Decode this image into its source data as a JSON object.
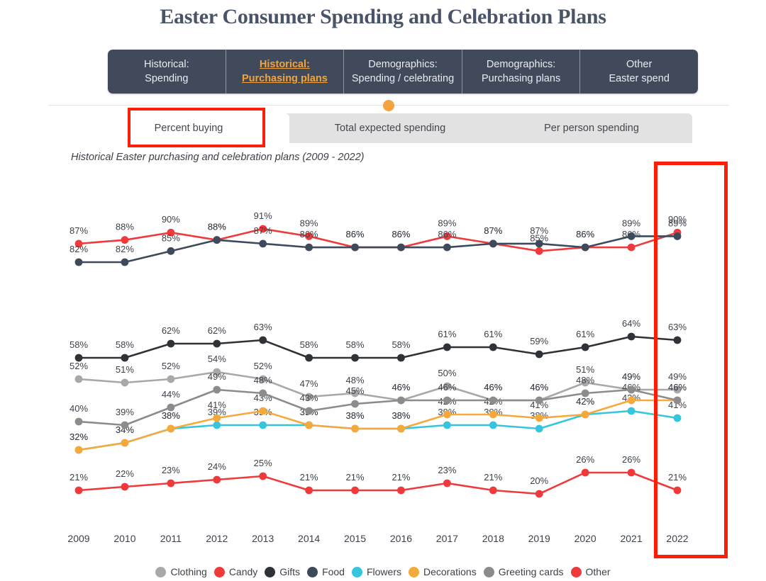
{
  "header": {
    "title": "Easter Consumer Spending and Celebration Plans"
  },
  "topnav": {
    "items": [
      {
        "line1": "Historical:",
        "line2": "Spending",
        "active": false
      },
      {
        "line1": "Historical:",
        "line2": "Purchasing plans",
        "active": true
      },
      {
        "line1": "Demographics:",
        "line2": "Spending / celebrating",
        "active": false
      },
      {
        "line1": "Demographics:",
        "line2": "Purchasing plans",
        "active": false
      },
      {
        "line1": "Other",
        "line2": "Easter spend",
        "active": false
      }
    ]
  },
  "subtabs": {
    "items": [
      {
        "label": "Percent buying",
        "active": true
      },
      {
        "label": "Total expected spending",
        "active": false
      },
      {
        "label": "Per person spending",
        "active": false
      }
    ]
  },
  "caption": {
    "text": "Historical Easter purchasing and celebration plans (2009 - 2022)"
  },
  "annotations": {
    "subtab_highlight_color": "#fb1e09",
    "year_highlight_color": "#fb1e09",
    "highlighted_subtab": "Percent buying",
    "highlighted_year": "2022",
    "orange_dot_color": "#f4a340"
  },
  "chart_data": {
    "type": "line",
    "title": "Historical Easter purchasing and celebration plans (2009 - 2022)",
    "xlabel": "",
    "ylabel": "",
    "ylim": [
      0,
      100
    ],
    "grid": false,
    "legend_position": "bottom",
    "value_suffix": "%",
    "categories": [
      "2009",
      "2010",
      "2011",
      "2012",
      "2013",
      "2014",
      "2015",
      "2016",
      "2017",
      "2018",
      "2019",
      "2020",
      "2021",
      "2022"
    ],
    "series": [
      {
        "name": "Clothing",
        "color": "#a8a8a8",
        "values": [
          52,
          51,
          52,
          54,
          52,
          47,
          48,
          46,
          50,
          46,
          46,
          51,
          49,
          49
        ]
      },
      {
        "name": "Candy",
        "color": "#f0393a",
        "values": [
          87,
          88,
          90,
          88,
          91,
          89,
          86,
          86,
          89,
          87,
          85,
          86,
          86,
          90
        ]
      },
      {
        "name": "Gifts",
        "color": "#2f3337",
        "values": [
          58,
          58,
          62,
          62,
          63,
          58,
          58,
          58,
          61,
          61,
          59,
          61,
          64,
          63
        ]
      },
      {
        "name": "Food",
        "color": "#3c4a5c",
        "values": [
          82,
          82,
          85,
          88,
          87,
          86,
          86,
          86,
          86,
          87,
          87,
          86,
          89,
          89
        ]
      },
      {
        "name": "Flowers",
        "color": "#35c6dd",
        "values": [
          32,
          34,
          38,
          39,
          39,
          39,
          38,
          38,
          39,
          39,
          38,
          42,
          43,
          41
        ]
      },
      {
        "name": "Decorations",
        "color": "#f6a93b",
        "values": [
          32,
          34,
          38,
          41,
          43,
          39,
          38,
          38,
          42,
          42,
          41,
          42,
          46,
          46
        ]
      },
      {
        "name": "Greeting cards",
        "color": "#8c8c8c",
        "values": [
          40,
          39,
          44,
          49,
          48,
          43,
          45,
          46,
          46,
          46,
          46,
          48,
          49,
          46
        ]
      },
      {
        "name": "Other",
        "color": "#f0393a",
        "values": [
          21,
          22,
          23,
          24,
          25,
          21,
          21,
          21,
          23,
          21,
          20,
          26,
          26,
          21
        ]
      }
    ]
  }
}
